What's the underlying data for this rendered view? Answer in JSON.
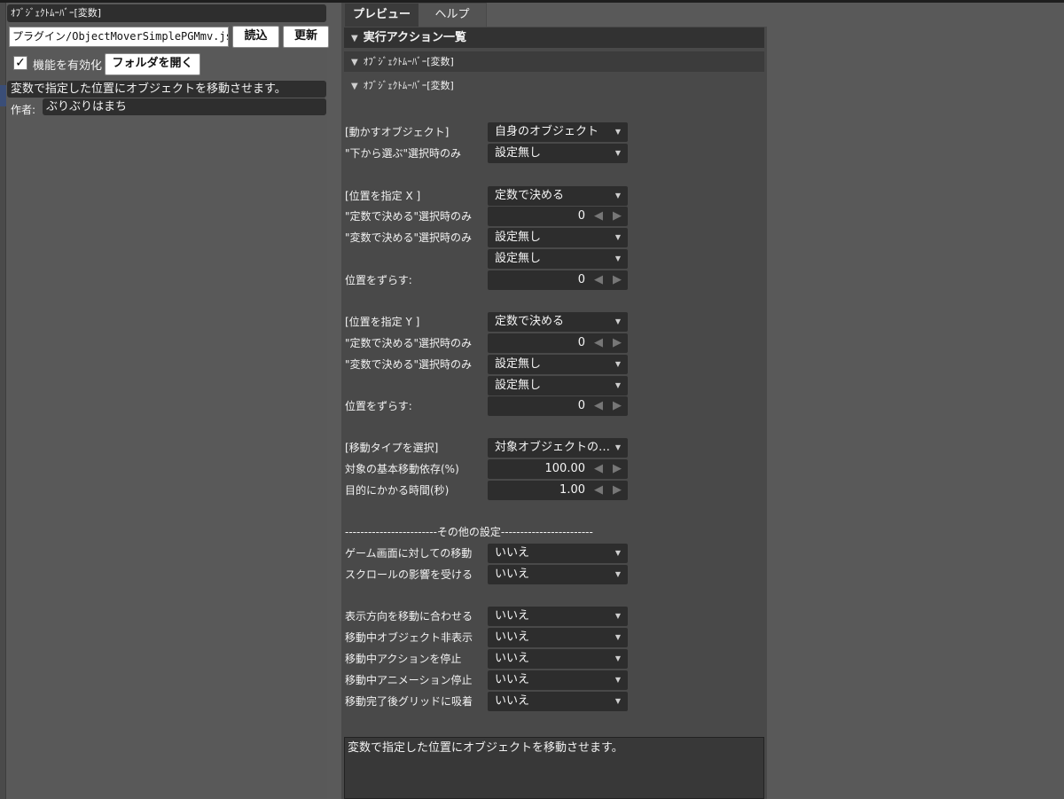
{
  "left_panel": {
    "title": "ｵﾌﾞｼﾞｪｸﾄﾑｰﾊﾞｰ[変数]",
    "path_value": "プラグイン/ObjectMoverSimplePGMmv.js",
    "load_label": "読込",
    "update_label": "更新",
    "enable_checked": "✓",
    "enable_label": "機能を有効化",
    "open_folder_label": "フォルダを開く",
    "description": "変数で指定した位置にオブジェクトを移動させます。",
    "author_label": "作者:",
    "author_value": "ぶりぶりはまち"
  },
  "tabs": [
    {
      "label": "プレビュー",
      "active": true
    },
    {
      "label": "ヘルプ",
      "active": false
    }
  ],
  "sections": [
    {
      "label": "実行アクション一覧"
    },
    {
      "label": "ｵﾌﾞｼﾞｪｸﾄﾑｰﾊﾞｰ[変数]"
    },
    {
      "label": "ｵﾌﾞｼﾞｪｸﾄﾑｰﾊﾞｰ[変数]"
    }
  ],
  "icons": {
    "collapse": "▼",
    "dropdown": "▼",
    "spin_left": "◀",
    "spin_right": "▶"
  },
  "form": {
    "object_label": "[動かすオブジェクト]",
    "object_value": "自身のオブジェクト",
    "object_sub_label": "\"下から選ぶ\"選択時のみ",
    "object_sub_value": "設定無し",
    "x_label": "[位置を指定 X ]",
    "x_value": "定数で決める",
    "x_const_label": "\"定数で決める\"選択時のみ",
    "x_const_value": "0",
    "x_var_label": "\"変数で決める\"選択時のみ",
    "x_var_value1": "設定無し",
    "x_var_value2": "設定無し",
    "x_offset_label": "位置をずらす:",
    "x_offset_value": "0",
    "y_label": "[位置を指定 Y ]",
    "y_value": "定数で決める",
    "y_const_label": "\"定数で決める\"選択時のみ",
    "y_const_value": "0",
    "y_var_label": "\"変数で決める\"選択時のみ",
    "y_var_value1": "設定無し",
    "y_var_value2": "設定無し",
    "y_offset_label": "位置をずらす:",
    "y_offset_value": "0",
    "move_type_label": "[移動タイプを選択]",
    "move_type_value": "対象オブジェクトの…",
    "base_move_label": "対象の基本移動依存(%)",
    "base_move_value": "100.00",
    "time_label": "目的にかかる時間(秒)",
    "time_value": "1.00",
    "other_divider": "------------------------その他の設定------------------------",
    "screen_move_label": "ゲーム画面に対しての移動",
    "screen_move_value": "いいえ",
    "scroll_label": "スクロールの影響を受ける",
    "scroll_value": "いいえ",
    "direction_label": "表示方向を移動に合わせる",
    "direction_value": "いいえ",
    "hide_label": "移動中オブジェクト非表示",
    "hide_value": "いいえ",
    "stop_action_label": "移動中アクションを停止",
    "stop_action_value": "いいえ",
    "stop_anim_label": "移動中アニメーション停止",
    "stop_anim_value": "いいえ",
    "snap_label": "移動完了後グリッドに吸着",
    "snap_value": "いいえ"
  },
  "bottom_description": "変数で指定した位置にオブジェクトを移動させます。"
}
